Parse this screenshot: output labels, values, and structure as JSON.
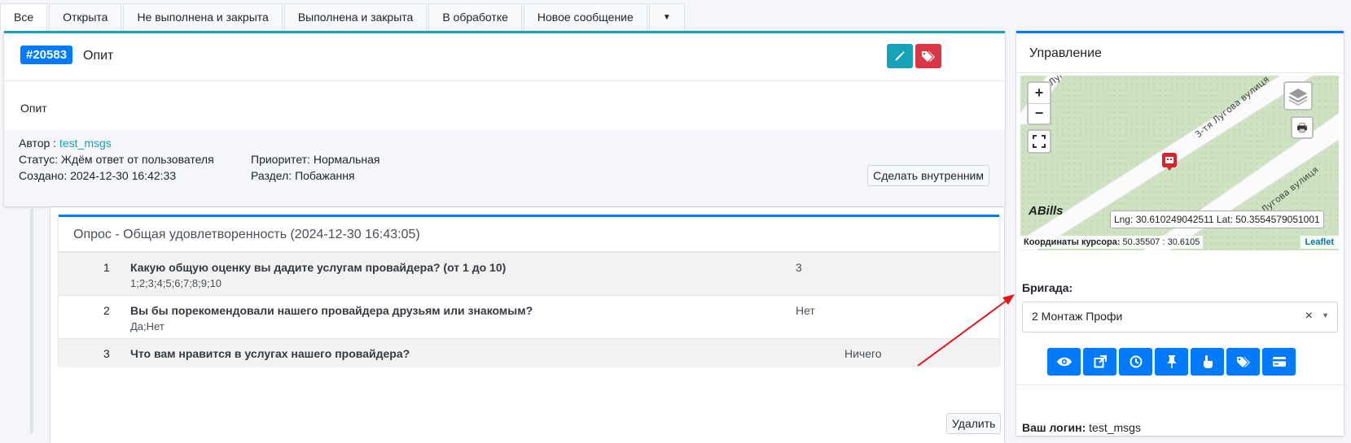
{
  "tabs": [
    "Все",
    "Открыта",
    "Не выполнена и закрыта",
    "Выполнена и закрыта",
    "В обработке",
    "Новое сообщение"
  ],
  "ticket": {
    "id": "#20583",
    "title": "Опит",
    "body": "Опит",
    "author_label": "Автор :",
    "author": "test_msgs",
    "status_label": "Статус:",
    "status": "Ждём ответ от пользователя",
    "created_label": "Создано:",
    "created": "2024-12-30 16:42:33",
    "priority_label": "Приоритет:",
    "priority": "Нормальная",
    "section_label": "Раздел:",
    "section": "Побажання",
    "make_internal": "Сделать внутренним"
  },
  "survey": {
    "title": "Опрос - Общая удовлетворенность (2024-12-30 16:43:05)",
    "rows": [
      {
        "n": "1",
        "q": "Какую общую оценку вы дадите услугам провайдера? (от 1 до 10)",
        "options": "1;2;3;4;5;6;7;8;9;10",
        "answer": "3"
      },
      {
        "n": "2",
        "q": "Вы бы порекомендовали нашего провайдера друзьям или знакомым?",
        "options": "Да;Нет",
        "answer": "Нет"
      },
      {
        "n": "3",
        "q": "Что вам нравится в услугах нашего провайдера?",
        "options": "",
        "answer": "Ничего"
      }
    ],
    "delete": "Удалить"
  },
  "panel": {
    "title": "Управление",
    "map": {
      "street1": "3-тя Лугова вулиця",
      "street2": "3-тя Лугова вулиця",
      "street3": "Лугова",
      "coords_popup": "Lng: 30.610249042511 Lat: 50.3554579051001",
      "cursor_label": "Координаты курсора:",
      "cursor_value": "50.35507 : 30.6105",
      "attribution": "Leaflet",
      "logo": "ABills",
      "zoom_in": "+",
      "zoom_out": "−"
    },
    "brigade_label": "Бригада:",
    "brigade_value": "2 Монтаж Профи",
    "login_label": "Ваш логин:",
    "login_value": "test_msgs"
  },
  "colors": {
    "primary": "#007bff",
    "info": "#17a2b8",
    "danger": "#dc3545",
    "annotation_arrow": "#e8141c"
  }
}
